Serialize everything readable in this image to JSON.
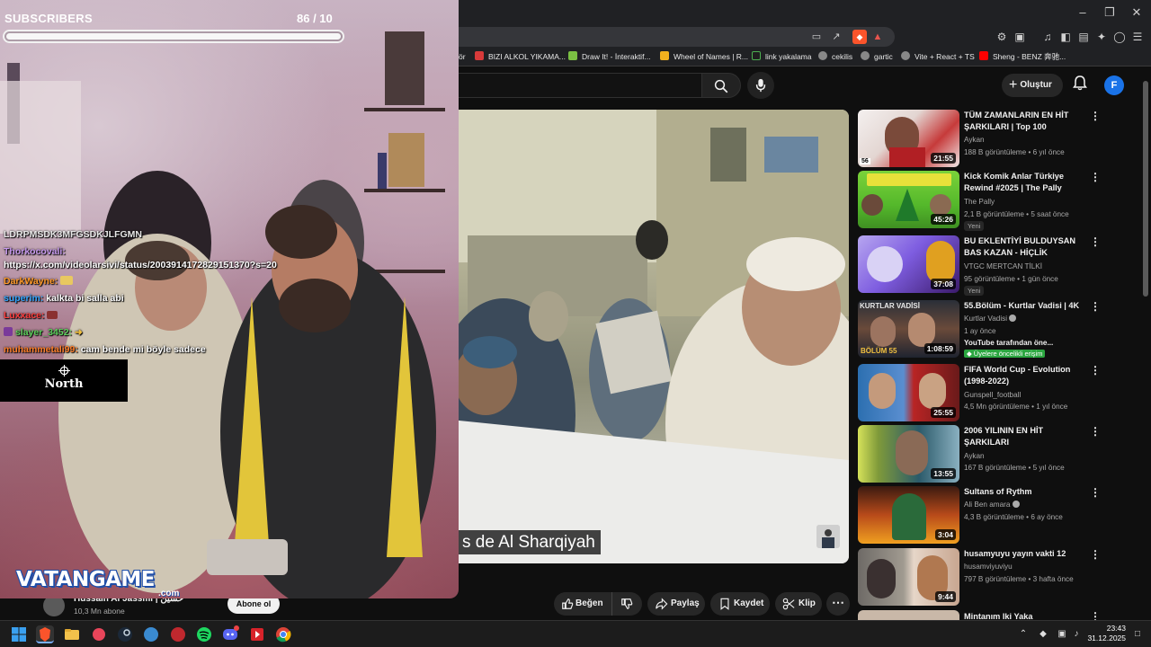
{
  "overlay": {
    "subscribers_label": "SUBSCRIBERS",
    "subscribers_count": "86  / 10",
    "progress_fraction": 1.0,
    "chat": [
      {
        "user": "LDRPMSDK3MFGSDKJLFGMN",
        "msg": "",
        "color": "#e8e8e8"
      },
      {
        "user": "Thorkocovali:",
        "msg": "",
        "color": "#c89af0"
      },
      {
        "user": "",
        "msg": "https://x.com/videolarsivi/status/2003914172829151370?s=20",
        "color": "#ffffff"
      },
      {
        "user": "DarkWayne:",
        "msg": "",
        "color": "#ff9a2a"
      },
      {
        "user": "superim:",
        "msg": "kalkta bi salla abi",
        "color": "#33a6ff"
      },
      {
        "user": "Luxxace:",
        "msg": "",
        "color": "#ff3d3d"
      },
      {
        "user": "slayer_3452:",
        "msg": "",
        "color": "#5dd05d"
      },
      {
        "user": "muhammetali99:",
        "msg": "cam bende mi böyle sadece",
        "color": "#ff7f2a"
      }
    ],
    "north_label": "North",
    "vatan_logo": "VATANGAME",
    "vatan_suffix": ".com"
  },
  "browser": {
    "bookmarks": [
      {
        "label": "ör",
        "color": "#999999"
      },
      {
        "label": "BIZI ALKOL YIKAMA...",
        "color": "#d83a3a"
      },
      {
        "label": "Draw It! - İnteraktif...",
        "color": "#7bc043"
      },
      {
        "label": "Wheel of Names | R...",
        "color": "#f2b01e"
      },
      {
        "label": "link yakalama",
        "color": "#1f1f1f"
      },
      {
        "label": "cekilis",
        "color": "#aaaaaa"
      },
      {
        "label": "gartic",
        "color": "#aaaaaa"
      },
      {
        "label": "Vite + React + TS",
        "color": "#aaaaaa"
      },
      {
        "label": "Sheng - BENZ 奔驰...",
        "color": "#ff0000"
      }
    ]
  },
  "youtube": {
    "create_label": "Oluştur",
    "avatar_letter": "F",
    "subtitle": "s de Al Sharqiyah",
    "channel_name": "Hussain Al Jassmi | حسين",
    "channel_subs": "10,3 Mn abone",
    "subscribe_label": "Abone ol",
    "actions": {
      "like": "Beğen",
      "share": "Paylaş",
      "save": "Kaydet",
      "clip": "Klip"
    },
    "sidebar": [
      {
        "title": "TÜM ZAMANLARIN EN HİT ŞARKILARI | Top 100",
        "channel": "Aykan",
        "meta": "188 B görüntüleme • 6 yıl önce",
        "duration": "21:55",
        "badge": "",
        "extra": "",
        "extra2": ""
      },
      {
        "title": "Kick Komik Anlar Türkiye Rewind #2025 | The Pally",
        "channel": "The Pally",
        "meta": "2,1 B görüntüleme • 5 saat önce",
        "duration": "45:26",
        "badge": "Yeni",
        "extra": "",
        "extra2": ""
      },
      {
        "title": "BU EKLENTİYİ BULDUYSAN BAS KAZAN - HİÇLİK EKLENTİSİ - ...",
        "channel": "VTGC MERTCAN TİLKİ",
        "meta": "95 görüntüleme • 1 gün önce",
        "duration": "37:08",
        "badge": "Yeni",
        "extra": "",
        "extra2": ""
      },
      {
        "title": "55.Bölüm - Kurtlar Vadisi | 4K",
        "channel": "Kurtlar Vadisi",
        "meta": "1 ay önce",
        "duration": "1:08:59",
        "badge": "",
        "extra": "YouTube tarafından öne...",
        "extra2": "Üyelere öncelikli erişim"
      },
      {
        "title": "FIFA World Cup - Evolution (1998-2022)",
        "channel": "Gunspell_football",
        "meta": "4,5 Mn görüntüleme • 1 yıl önce",
        "duration": "25:55",
        "badge": "",
        "extra": "",
        "extra2": ""
      },
      {
        "title": "2006 YILININ EN HİT ŞARKILARI",
        "channel": "Aykan",
        "meta": "167 B görüntüleme • 5 yıl önce",
        "duration": "13:55",
        "badge": "",
        "extra": "",
        "extra2": ""
      },
      {
        "title": "Sultans of Rythm",
        "channel": "Ali Ben amara",
        "meta": "4,3 B görüntüleme • 6 ay önce",
        "duration": "3:04",
        "badge": "",
        "extra": "",
        "extra2": ""
      },
      {
        "title": "husamyuyu yayın vakti 12",
        "channel": "husamviyuviyu",
        "meta": "797 B görüntüleme • 3 hafta önce",
        "duration": "9:44",
        "badge": "",
        "extra": "",
        "extra2": ""
      },
      {
        "title": "Mintanım Iki Yaka",
        "channel": "",
        "meta": "",
        "duration": "",
        "badge": "",
        "extra": "",
        "extra2": ""
      }
    ]
  },
  "taskbar": {
    "time": "23:43",
    "date": "31.12.2025"
  },
  "colors": {
    "youtube_red": "#ff0000",
    "member_green": "#2ba640",
    "avatar_blue": "#1a73e8"
  }
}
